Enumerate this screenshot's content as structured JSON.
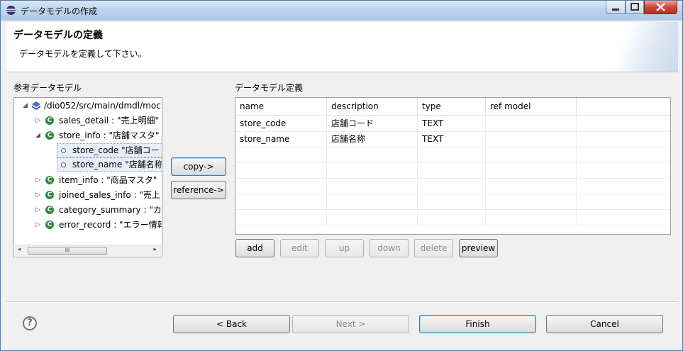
{
  "window": {
    "title": "データモデルの作成"
  },
  "banner": {
    "title": "データモデルの定義",
    "description": "データモデルを定義して下さい。"
  },
  "left": {
    "label": "参考データモデル",
    "tree": [
      {
        "text": "/dio052/src/main/dmdl/moc",
        "expand": "◢",
        "icon": "package-icon"
      },
      {
        "text": "sales_detail : \"売上明細\"",
        "expand": "▷",
        "icon": "model-icon"
      },
      {
        "text": "store_info : \"店舗マスタ\"",
        "expand": "◢",
        "icon": "model-icon"
      },
      {
        "text": "store_code \"店舗コー",
        "expand": "",
        "icon": "property-icon"
      },
      {
        "text": "store_name \"店舗名称",
        "expand": "",
        "icon": "property-icon"
      },
      {
        "text": "item_info : \"商品マスタ\"",
        "expand": "▷",
        "icon": "model-icon"
      },
      {
        "text": "joined_sales_info : \"売上",
        "expand": "▷",
        "icon": "model-icon"
      },
      {
        "text": "category_summary : \"カ",
        "expand": "▷",
        "icon": "model-icon"
      },
      {
        "text": "error_record : \"エラー情報",
        "expand": "▷",
        "icon": "model-icon"
      }
    ],
    "scroll_grip": "III"
  },
  "middle": {
    "copy_label": "copy->",
    "reference_label": "reference->"
  },
  "right": {
    "label": "データモデル定義",
    "columns": [
      "name",
      "description",
      "type",
      "ref model"
    ],
    "rows": [
      [
        "store_code",
        "店舗コード",
        "TEXT",
        ""
      ],
      [
        "store_name",
        "店舗名称",
        "TEXT",
        ""
      ]
    ],
    "buttons": {
      "add": "add",
      "edit": "edit",
      "up": "up",
      "down": "down",
      "delete": "delete",
      "preview": "preview"
    }
  },
  "footer": {
    "help": "?",
    "back": "< Back",
    "next": "Next >",
    "finish": "Finish",
    "cancel": "Cancel"
  },
  "colors": {
    "title_bar": "#bcd3ec",
    "close_button": "#c9493a",
    "accent_icon": "#2e8b3a"
  }
}
